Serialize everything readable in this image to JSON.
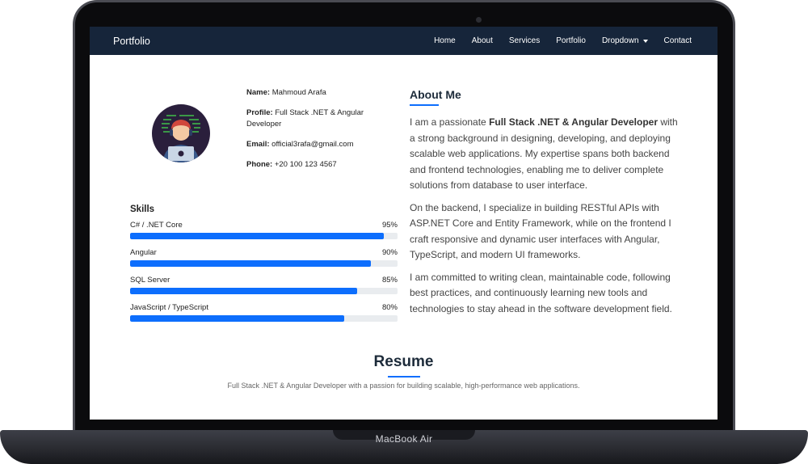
{
  "device": {
    "label": "MacBook Air"
  },
  "navbar": {
    "brand": "Portfolio",
    "items": [
      {
        "label": "Home"
      },
      {
        "label": "About"
      },
      {
        "label": "Services"
      },
      {
        "label": "Portfolio"
      },
      {
        "label": "Dropdown"
      },
      {
        "label": "Contact"
      }
    ]
  },
  "profile": {
    "name_key": "Name:",
    "name_value": "Mahmoud Arafa",
    "profile_key": "Profile:",
    "profile_value": "Full Stack .NET & Angular Developer",
    "email_key": "Email:",
    "email_value": "official3rafa@gmail.com",
    "phone_key": "Phone:",
    "phone_value": "+20 100 123 4567"
  },
  "skills": {
    "title": "Skills",
    "items": [
      {
        "name": "C# / .NET Core",
        "percent_label": "95%",
        "percent": 95
      },
      {
        "name": "Angular",
        "percent_label": "90%",
        "percent": 90
      },
      {
        "name": "SQL Server",
        "percent_label": "85%",
        "percent": 85
      },
      {
        "name": "JavaScript / TypeScript",
        "percent_label": "80%",
        "percent": 80
      }
    ]
  },
  "about": {
    "title": "About Me",
    "p1_pre": "I am a passionate ",
    "p1_bold": "Full Stack .NET & Angular Developer",
    "p1_post": " with a strong background in designing, developing, and deploying scalable web applications. My expertise spans both backend and frontend technologies, enabling me to deliver complete solutions from database to user interface.",
    "p2": "On the backend, I specialize in building RESTful APIs with ASP.NET Core and Entity Framework, while on the frontend I craft responsive and dynamic user interfaces with Angular, TypeScript, and modern UI frameworks.",
    "p3": "I am committed to writing clean, maintainable code, following best practices, and continuously learning new tools and technologies to stay ahead in the software development field."
  },
  "resume": {
    "title": "Resume",
    "subtitle": "Full Stack .NET & Angular Developer with a passion for building scalable, high-performance web applications."
  },
  "colors": {
    "navbar": "#16253a",
    "accent": "#0d6efd"
  }
}
